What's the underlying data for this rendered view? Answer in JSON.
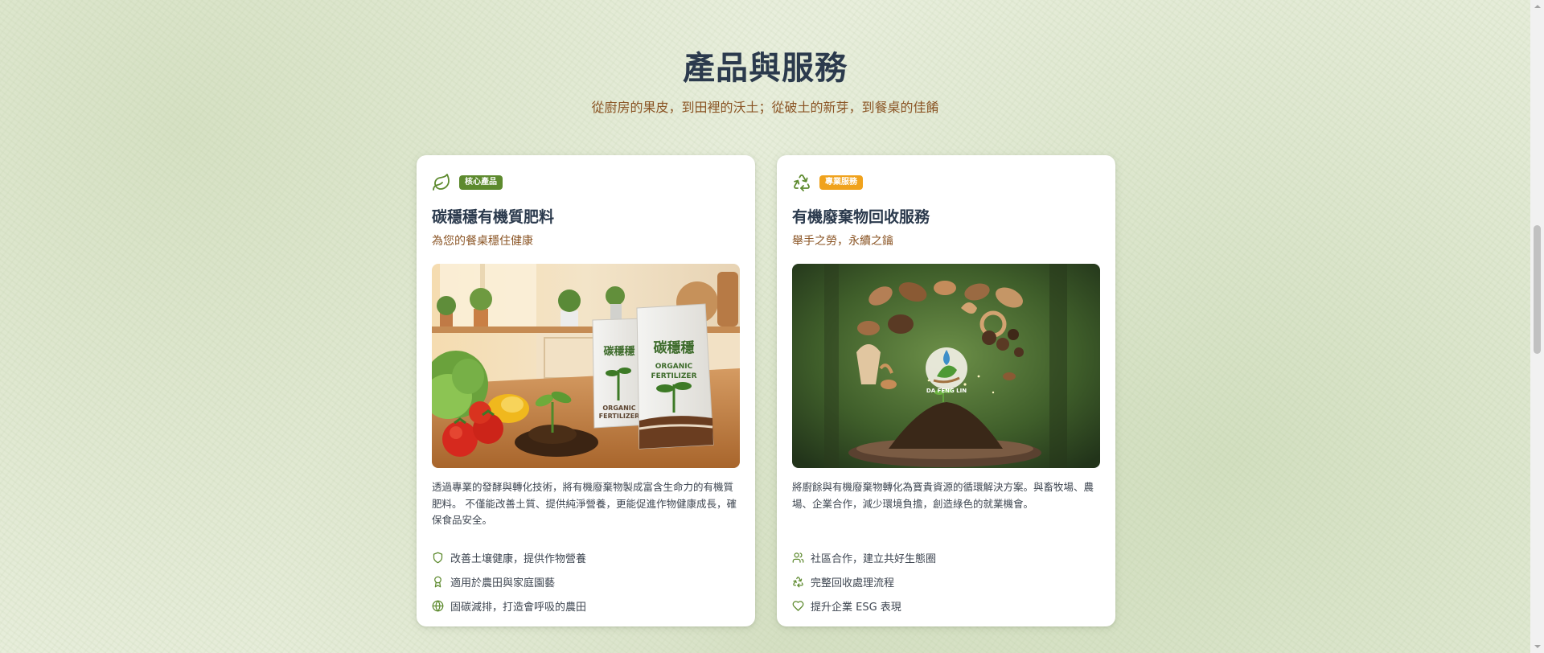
{
  "section": {
    "title": "產品與服務",
    "subtitle": "從廚房的果皮，到田裡的沃土；從破土的新芽，到餐桌的佳餚"
  },
  "cards": [
    {
      "badge": "核心產品",
      "badge_color": "#5d8a2e",
      "icon": "leaf-icon",
      "title": "碳穩穩有機質肥料",
      "tagline": "為您的餐桌穩住健康",
      "image": {
        "bag_brand": "碳穩穩",
        "bag_label_line1": "ORGANIC",
        "bag_label_line2": "FERTILIZER"
      },
      "description": "透過專業的發酵與轉化技術，將有機廢棄物製成富含生命力的有機質肥料。 不僅能改善土質、提供純淨營養，更能促進作物健康成長，確保食品安全。",
      "features": [
        {
          "icon": "shield-icon",
          "text": "改善土壤健康，提供作物營養"
        },
        {
          "icon": "award-icon",
          "text": "適用於農田與家庭園藝"
        },
        {
          "icon": "globe-icon",
          "text": "固碳減排，打造會呼吸的農田"
        }
      ]
    },
    {
      "badge": "專業服務",
      "badge_color": "#f0a21c",
      "icon": "recycle-icon",
      "title": "有機廢棄物回收服務",
      "tagline": "舉手之勞，永續之鑰",
      "image": {
        "logo_text": "DA FENG LIN"
      },
      "description": "將廚餘與有機廢棄物轉化為寶貴資源的循環解決方案。與畜牧場、農場、企業合作，減少環境負擔，創造綠色的就業機會。",
      "features": [
        {
          "icon": "users-icon",
          "text": "社區合作，建立共好生態圈"
        },
        {
          "icon": "recycle-icon",
          "text": "完整回收處理流程"
        },
        {
          "icon": "heart-icon",
          "text": "提升企業 ESG 表現"
        }
      ]
    }
  ]
}
